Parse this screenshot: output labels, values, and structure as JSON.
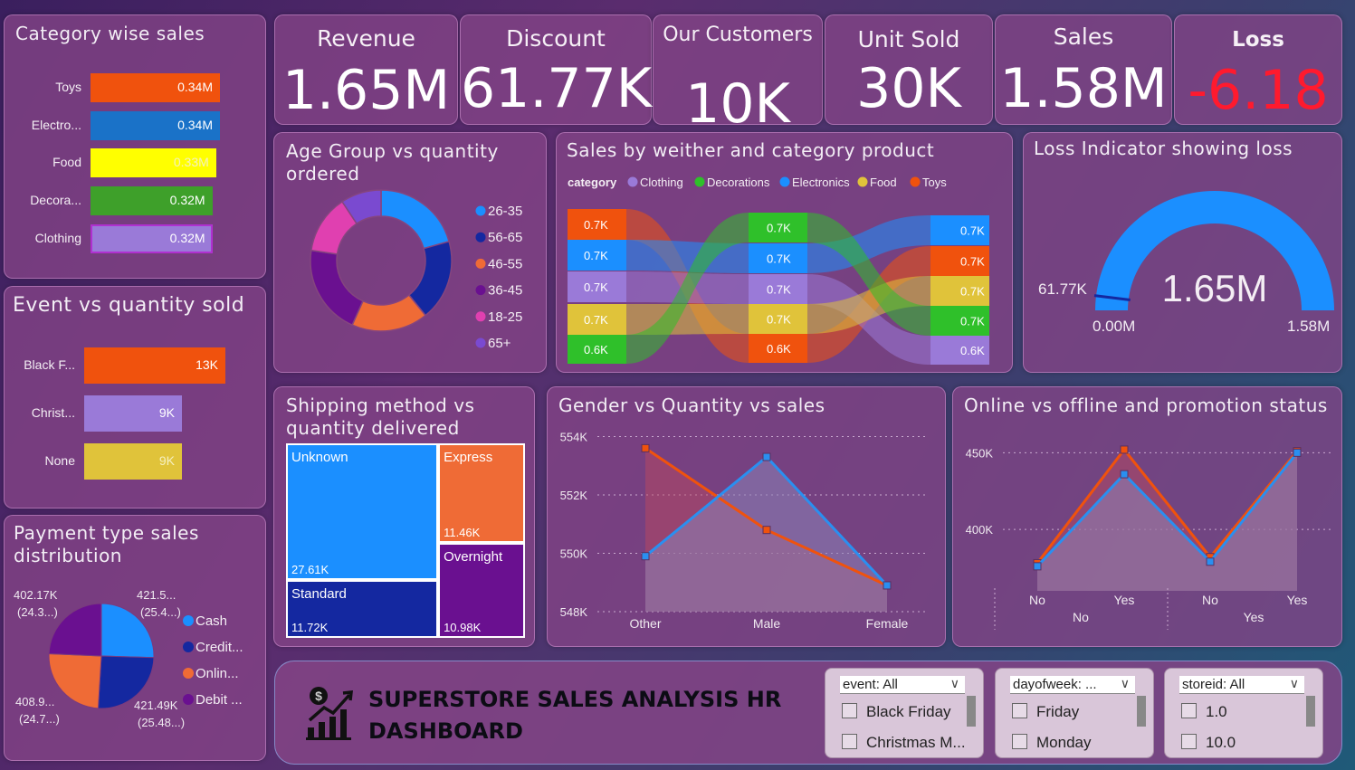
{
  "kpis": [
    {
      "label": "Revenue",
      "value": "1.65M"
    },
    {
      "label": "Discount",
      "value": "61.77K"
    },
    {
      "label": "Our Customers",
      "value": "10K"
    },
    {
      "label": "Unit Sold",
      "value": "30K"
    },
    {
      "label": "Sales",
      "value": "1.58M"
    },
    {
      "label": "Loss",
      "value": "-6.18"
    }
  ],
  "colors": {
    "loss_value": "#ff1a2e",
    "orange": "#f0520d",
    "blue": "#1b8fff",
    "navy": "#1428a0",
    "purple": "#7a1aa0",
    "yellow": "#ffff00",
    "green": "#3ea02a",
    "lavender": "#9a7ad8"
  },
  "titles": {
    "category_sales": "Category wise sales",
    "event_qty": "Event vs quantity sold",
    "payment": "Payment type sales distribution",
    "age_group": "Age Group vs quantity ordered",
    "weather": "Sales by weither and category product",
    "loss_indicator": "Loss Indicator showing loss",
    "shipping": "Shipping method vs quantity delivered",
    "gender": "Gender vs Quantity vs sales",
    "online": "Online vs offline and promotion status"
  },
  "chart_data": [
    {
      "id": "category_sales",
      "type": "bar",
      "orientation": "horizontal",
      "categories": [
        "Toys",
        "Electro...",
        "Food",
        "Decora...",
        "Clothing"
      ],
      "values": [
        0.34,
        0.34,
        0.33,
        0.32,
        0.32
      ],
      "labels": [
        "0.34M",
        "0.34M",
        "0.33M",
        "0.32M",
        "0.32M"
      ],
      "colors": [
        "#f0520d",
        "#1a72c8",
        "#ffff00",
        "#3ea02a",
        "#9a7ad8"
      ],
      "xlim": [
        0,
        0.34
      ]
    },
    {
      "id": "event_qty",
      "type": "bar",
      "orientation": "horizontal",
      "categories": [
        "Black F...",
        "Christ...",
        "None"
      ],
      "values": [
        13,
        9,
        9
      ],
      "labels": [
        "13K",
        "9K",
        "9K"
      ],
      "colors": [
        "#f0520d",
        "#9a7ad8",
        "#e0c33a"
      ],
      "xlim": [
        0,
        13
      ]
    },
    {
      "id": "payment",
      "type": "pie",
      "categories": [
        "Cash",
        "Credit...",
        "Onlin...",
        "Debit ..."
      ],
      "values": [
        421.5,
        421.49,
        408.9,
        402.17
      ],
      "labels": [
        "421.5...",
        "421.49K",
        "408.9...",
        "402.17K"
      ],
      "percent_labels": [
        "(25.4...)",
        "(25.48...)",
        "(24.7...)",
        "(24.3...)"
      ],
      "colors": [
        "#1b8fff",
        "#1428a0",
        "#ef6b36",
        "#6a1090"
      ]
    },
    {
      "id": "age_group",
      "type": "pie",
      "donut": true,
      "categories": [
        "26-35",
        "56-65",
        "46-55",
        "36-45",
        "18-25",
        "65+"
      ],
      "values": [
        20,
        18,
        17,
        20,
        13,
        9
      ],
      "colors": [
        "#1b8fff",
        "#1428a0",
        "#ef6b36",
        "#6a1090",
        "#e040b0",
        "#7a4ad0"
      ]
    },
    {
      "id": "weather",
      "type": "table",
      "subtype": "ribbon",
      "legend_title": "category",
      "legend": [
        "Clothing",
        "Decorations",
        "Electronics",
        "Food",
        "Toys"
      ],
      "legend_colors": [
        "#9a7ad8",
        "#2fc02a",
        "#1b8fff",
        "#e0c33a",
        "#f0520d"
      ],
      "columns": [
        {
          "order": [
            "Toys",
            "Electronics",
            "Clothing",
            "Food",
            "Decorations"
          ],
          "labels": [
            "0.7K",
            "0.7K",
            "0.7K",
            "0.7K",
            "0.6K"
          ]
        },
        {
          "order": [
            "Decorations",
            "Electronics",
            "Clothing",
            "Food",
            "Toys"
          ],
          "labels": [
            "0.7K",
            "0.7K",
            "0.7K",
            "0.7K",
            "0.6K"
          ]
        },
        {
          "order": [
            "Electronics",
            "Toys",
            "Food",
            "Decorations",
            "Clothing"
          ],
          "labels": [
            "0.7K",
            "0.7K",
            "0.7K",
            "0.7K",
            "0.6K"
          ]
        }
      ],
      "colors_by_category": {
        "Clothing": "#9a7ad8",
        "Decorations": "#2fc02a",
        "Electronics": "#1b8fff",
        "Food": "#e0c33a",
        "Toys": "#f0520d"
      }
    },
    {
      "id": "loss_indicator",
      "type": "gauge",
      "value_label": "1.65M",
      "min_label": "0.00M",
      "max_label": "1.58M",
      "target_label": "61.77K",
      "min": 0,
      "max": 1.58,
      "value": 1.65,
      "target": 0.06177,
      "color": "#1b8fff"
    },
    {
      "id": "shipping",
      "type": "heatmap",
      "subtype": "treemap",
      "categories": [
        "Unknown",
        "Standard",
        "Express",
        "Overnight"
      ],
      "values": [
        27.61,
        11.72,
        11.46,
        10.98
      ],
      "labels": [
        "27.61K",
        "11.72K",
        "11.46K",
        "10.98K"
      ],
      "colors": [
        "#1b8fff",
        "#1428a0",
        "#ef6b36",
        "#6a1090"
      ]
    },
    {
      "id": "gender",
      "type": "line",
      "categories": [
        "Other",
        "Male",
        "Female"
      ],
      "series": [
        {
          "values": [
            553.6,
            550.8,
            548.9
          ],
          "color": "#f0520d"
        },
        {
          "values": [
            549.9,
            553.3,
            548.9
          ],
          "color": "#2a8ff0"
        }
      ],
      "yticks": [
        "554K",
        "552K",
        "550K",
        "548K"
      ],
      "ylim": [
        548,
        554.2
      ]
    },
    {
      "id": "online",
      "type": "line",
      "categories": [
        "No",
        "Yes",
        "No",
        "Yes"
      ],
      "groups": [
        "No",
        "Yes"
      ],
      "series": [
        {
          "values": [
            378,
            452,
            382,
            451
          ],
          "color": "#f0520d"
        },
        {
          "values": [
            376,
            436,
            379,
            450
          ],
          "color": "#2a8ff0"
        }
      ],
      "yticks": [
        "450K",
        "400K"
      ],
      "ylim": [
        360,
        462
      ]
    }
  ],
  "banner": {
    "title_line1": "SUPERSTORE SALES ANALYSIS HR",
    "title_line2": "DASHBOARD",
    "slicers": [
      {
        "header": "event: All",
        "items": [
          "Black Friday",
          "Christmas M..."
        ]
      },
      {
        "header": "dayofweek: ...",
        "items": [
          "Friday",
          "Monday"
        ]
      },
      {
        "header": "storeid: All",
        "items": [
          "1.0",
          "10.0"
        ]
      }
    ]
  }
}
